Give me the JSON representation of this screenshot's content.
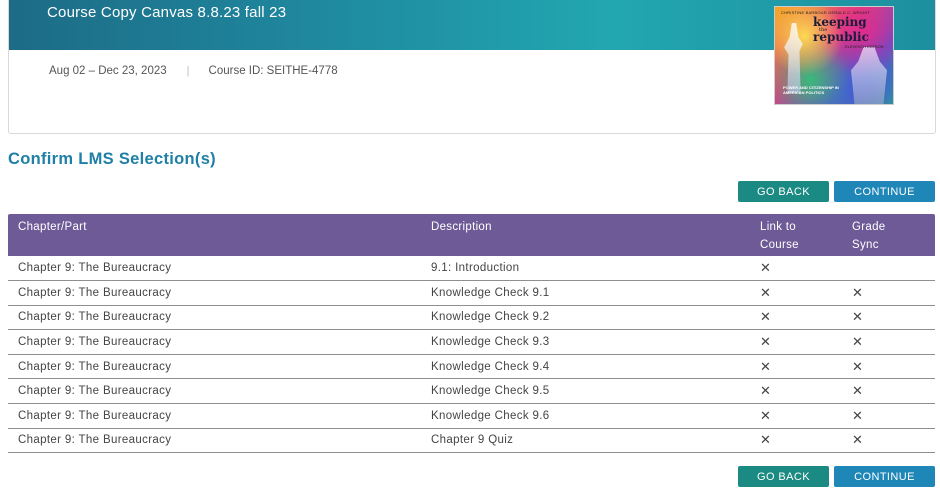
{
  "course": {
    "title": "Course Copy Canvas 8.8.23 fall 23",
    "dates": "Aug 02 – Dec 23, 2023",
    "separator": "|",
    "course_id": "Course ID: SEITHE-4778",
    "cover": {
      "authors": "CHRISTINE BARBOUR  GERALD C. WRIGHT",
      "title_line1": "keeping",
      "title_line2": "the",
      "title_line3": "republic",
      "edition": "ELEVENTH EDITION",
      "subtitle": "POWER AND CITIZENSHIP IN AMERICAN POLITICS"
    }
  },
  "section": {
    "heading": "Confirm LMS Selection(s)"
  },
  "actions": {
    "back_label": "GO BACK",
    "continue_label": "CONTINUE"
  },
  "table": {
    "headers": {
      "chapter": "Chapter/Part",
      "description": "Description",
      "link_line1": "Link to",
      "link_line2": "Course",
      "grade_line1": "Grade",
      "grade_line2": "Sync"
    },
    "mark_symbol": "✕",
    "rows": [
      {
        "chapter": "Chapter 9: The Bureaucracy",
        "description": "9.1: Introduction",
        "link": "✕",
        "grade": ""
      },
      {
        "chapter": "Chapter 9: The Bureaucracy",
        "description": "Knowledge Check 9.1",
        "link": "✕",
        "grade": "✕"
      },
      {
        "chapter": "Chapter 9: The Bureaucracy",
        "description": "Knowledge Check 9.2",
        "link": "✕",
        "grade": "✕"
      },
      {
        "chapter": "Chapter 9: The Bureaucracy",
        "description": "Knowledge Check 9.3",
        "link": "✕",
        "grade": "✕"
      },
      {
        "chapter": "Chapter 9: The Bureaucracy",
        "description": "Knowledge Check 9.4",
        "link": "✕",
        "grade": "✕"
      },
      {
        "chapter": "Chapter 9: The Bureaucracy",
        "description": "Knowledge Check 9.5",
        "link": "✕",
        "grade": "✕"
      },
      {
        "chapter": "Chapter 9: The Bureaucracy",
        "description": "Knowledge Check 9.6",
        "link": "✕",
        "grade": "✕"
      },
      {
        "chapter": "Chapter 9: The Bureaucracy",
        "description": "Chapter 9 Quiz",
        "link": "✕",
        "grade": "✕"
      }
    ]
  },
  "colors": {
    "banner": "#1f8aa0",
    "header_purple": "#6e5a96",
    "go_back": "#1b8a82",
    "continue": "#1f86b8",
    "heading_blue": "#1f7fa6"
  }
}
